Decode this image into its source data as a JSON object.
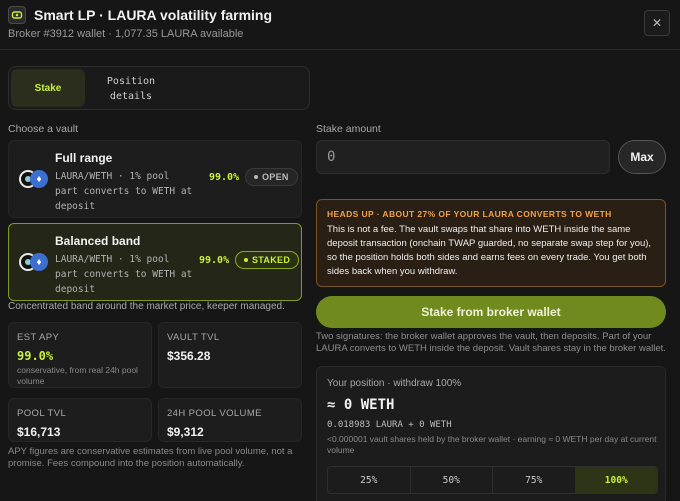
{
  "header": {
    "title": "Smart LP · LAURA volatility farming",
    "subtitle": "Broker #3912 wallet · 1,077.35 LAURA available",
    "close_symbol": "✕"
  },
  "tabs": [
    {
      "label": "Stake",
      "active": true
    },
    {
      "label": "Position details",
      "active": false
    }
  ],
  "vault_section": {
    "label": "Choose a vault",
    "vaults": [
      {
        "name": "Full range",
        "desc": "LAURA/WETH · 1% pool part converts to WETH at deposit",
        "apy": "99.0%",
        "status": "OPEN",
        "selected": false
      },
      {
        "name": "Balanced band",
        "desc": "LAURA/WETH · 1% pool part converts to WETH at deposit",
        "apy": "99.0%",
        "status": "STAKED",
        "selected": true
      }
    ],
    "band_note": "Concentrated band around the market price, keeper managed."
  },
  "stats": [
    {
      "label": "EST APY",
      "value": "99.0%",
      "note": "conservative, from real 24h pool volume",
      "accent": true
    },
    {
      "label": "VAULT TVL",
      "value": "$356.28",
      "note": ""
    },
    {
      "label": "POOL TVL",
      "value": "$16,713",
      "note": ""
    },
    {
      "label": "24H POOL VOLUME",
      "value": "$9,312",
      "note": ""
    }
  ],
  "apy_footnote": "APY figures are conservative estimates from live pool volume, not a promise. Fees compound into the position automatically.",
  "stake": {
    "label": "Stake amount",
    "placeholder": "0",
    "max_label": "Max"
  },
  "warning": {
    "title": "HEADS UP · ABOUT 27% OF YOUR LAURA CONVERTS TO WETH",
    "body": "This is not a fee. The vault swaps that share into WETH inside the same deposit transaction (onchain TWAP guarded, no separate swap step for you), so the position holds both sides and earns fees on every trade. You get both sides back when you withdraw."
  },
  "stake_button": "Stake from broker wallet",
  "signature_note": "Two signatures: the broker wallet approves the vault, then deposits. Part of your LAURA converts to WETH inside the deposit. Vault shares stay in the broker wallet.",
  "position": {
    "header": "Your position · withdraw 100%",
    "value": "≈ 0 WETH",
    "sub": "0.018983 LAURA + 0 WETH",
    "note": "<0.000001 vault shares held by the broker wallet · earning ≈ 0 WETH per day at current volume",
    "percentages": [
      "25%",
      "50%",
      "75%",
      "100%"
    ],
    "active_percent": "100%"
  },
  "colors": {
    "accent": "#c8f03c",
    "warning": "#f1a14a",
    "button": "#708a1d"
  }
}
